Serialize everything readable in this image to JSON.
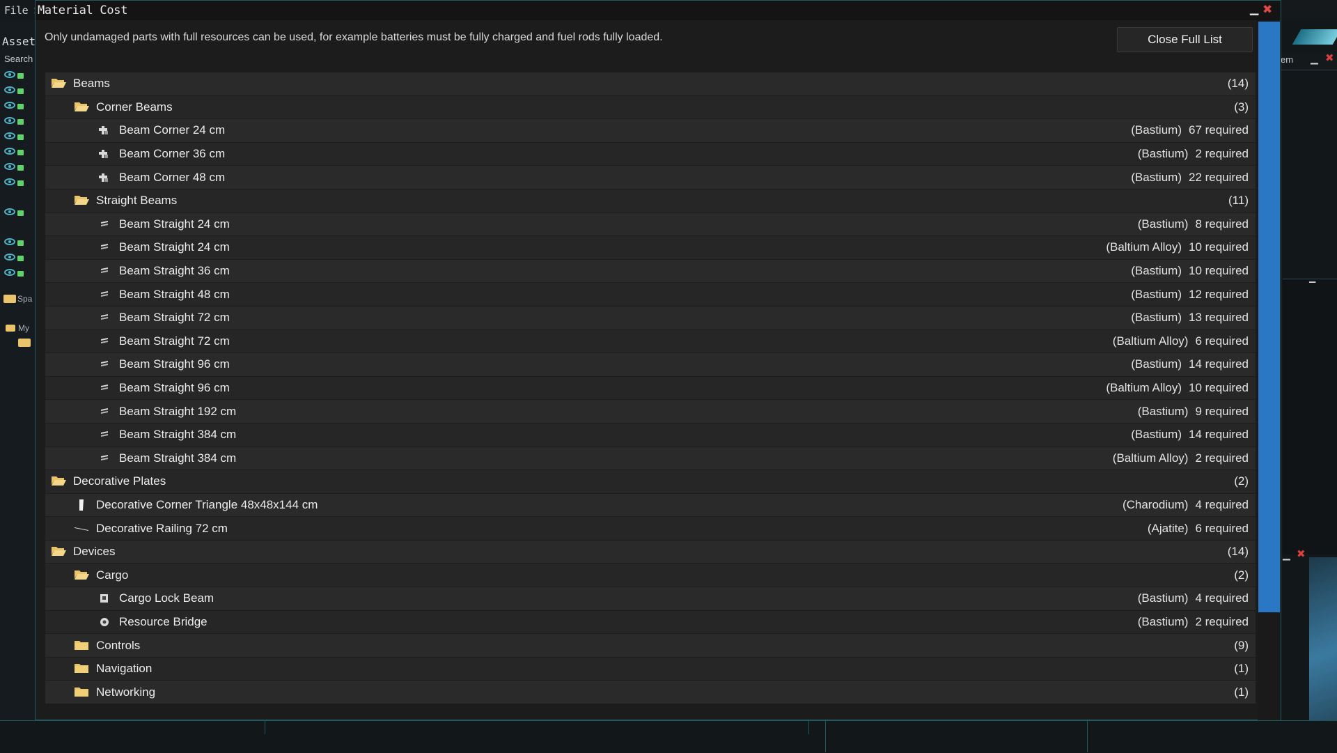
{
  "background": {
    "menu_file": "File Se",
    "left_title": "Asset",
    "left_search": "Search",
    "left_folder_1": "Spa",
    "left_folder_2": "My",
    "right_sub_title": "em"
  },
  "window": {
    "title": "Material Cost",
    "info_text": "Only undamaged parts with full resources can be used, for example batteries must be fully charged and fuel rods fully loaded.",
    "close_button_label": "Close Full List"
  },
  "rows": [
    {
      "level": 0,
      "type": "folder",
      "name": "Beams",
      "count": "(14)"
    },
    {
      "level": 1,
      "type": "folder",
      "name": "Corner Beams",
      "count": "(3)"
    },
    {
      "level": 2,
      "type": "item",
      "icon": "beam-corner-icon",
      "name": "Beam Corner 24 cm",
      "material": "(Bastium)",
      "required": "67 required"
    },
    {
      "level": 2,
      "type": "item",
      "icon": "beam-corner-icon",
      "name": "Beam Corner 36 cm",
      "material": "(Bastium)",
      "required": "2 required"
    },
    {
      "level": 2,
      "type": "item",
      "icon": "beam-corner-icon",
      "name": "Beam Corner 48 cm",
      "material": "(Bastium)",
      "required": "22 required"
    },
    {
      "level": 1,
      "type": "folder",
      "name": "Straight Beams",
      "count": "(11)"
    },
    {
      "level": 2,
      "type": "item",
      "icon": "beam-straight-icon",
      "name": "Beam Straight 24 cm",
      "material": "(Bastium)",
      "required": "8 required"
    },
    {
      "level": 2,
      "type": "item",
      "icon": "beam-straight-icon",
      "name": "Beam Straight 24 cm",
      "material": "(Baltium Alloy)",
      "required": "10 required"
    },
    {
      "level": 2,
      "type": "item",
      "icon": "beam-straight-icon",
      "name": "Beam Straight 36 cm",
      "material": "(Bastium)",
      "required": "10 required"
    },
    {
      "level": 2,
      "type": "item",
      "icon": "beam-straight-icon",
      "name": "Beam Straight 48 cm",
      "material": "(Bastium)",
      "required": "12 required"
    },
    {
      "level": 2,
      "type": "item",
      "icon": "beam-straight-icon",
      "name": "Beam Straight 72 cm",
      "material": "(Bastium)",
      "required": "13 required"
    },
    {
      "level": 2,
      "type": "item",
      "icon": "beam-straight-icon",
      "name": "Beam Straight 72 cm",
      "material": "(Baltium Alloy)",
      "required": "6 required"
    },
    {
      "level": 2,
      "type": "item",
      "icon": "beam-straight-icon",
      "name": "Beam Straight 96 cm",
      "material": "(Bastium)",
      "required": "14 required"
    },
    {
      "level": 2,
      "type": "item",
      "icon": "beam-straight-icon",
      "name": "Beam Straight 96 cm",
      "material": "(Baltium Alloy)",
      "required": "10 required"
    },
    {
      "level": 2,
      "type": "item",
      "icon": "beam-straight-icon",
      "name": "Beam Straight 192 cm",
      "material": "(Bastium)",
      "required": "9 required"
    },
    {
      "level": 2,
      "type": "item",
      "icon": "beam-straight-icon",
      "name": "Beam Straight 384 cm",
      "material": "(Bastium)",
      "required": "14 required"
    },
    {
      "level": 2,
      "type": "item",
      "icon": "beam-straight-icon",
      "name": "Beam Straight 384 cm",
      "material": "(Baltium Alloy)",
      "required": "2 required"
    },
    {
      "level": 0,
      "type": "folder",
      "name": "Decorative Plates",
      "count": "(2)"
    },
    {
      "level": 1,
      "type": "item",
      "icon": "decorative-triangle-icon",
      "name": "Decorative Corner Triangle 48x48x144 cm",
      "material": "(Charodium)",
      "required": "4 required"
    },
    {
      "level": 1,
      "type": "item",
      "icon": "decorative-railing-icon",
      "name": "Decorative Railing 72 cm",
      "material": "(Ajatite)",
      "required": "6 required"
    },
    {
      "level": 0,
      "type": "folder",
      "name": "Devices",
      "count": "(14)"
    },
    {
      "level": 1,
      "type": "folder",
      "name": "Cargo",
      "count": "(2)"
    },
    {
      "level": 2,
      "type": "item",
      "icon": "cargo-lock-icon",
      "name": "Cargo Lock Beam",
      "material": "(Bastium)",
      "required": "4 required"
    },
    {
      "level": 2,
      "type": "item",
      "icon": "resource-bridge-icon",
      "name": "Resource Bridge",
      "material": "(Bastium)",
      "required": "2 required"
    },
    {
      "level": 1,
      "type": "folder-closed",
      "name": "Controls",
      "count": "(9)"
    },
    {
      "level": 1,
      "type": "folder-closed",
      "name": "Navigation",
      "count": "(1)"
    },
    {
      "level": 1,
      "type": "folder-closed",
      "name": "Networking",
      "count": "(1)"
    }
  ],
  "colors": {
    "folder": "#e9c46a",
    "scrollbar": "#2a77c4",
    "close": "#e04848"
  }
}
